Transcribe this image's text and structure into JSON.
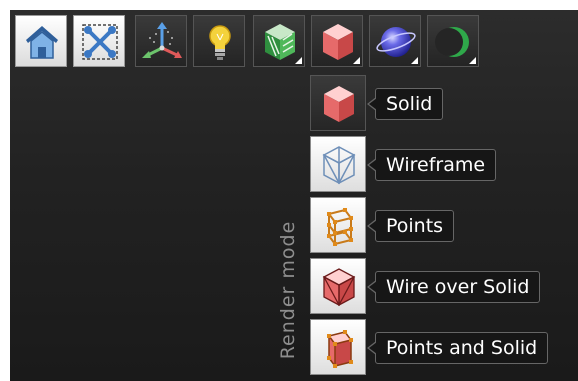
{
  "toolbar": {
    "buttons": [
      {
        "name": "home",
        "icon": "home-icon"
      },
      {
        "name": "fit-view",
        "icon": "fit-view-icon"
      },
      {
        "name": "axes",
        "icon": "axes-icon"
      },
      {
        "name": "light",
        "icon": "lightbulb-icon"
      },
      {
        "name": "shading",
        "icon": "striped-cube-icon"
      },
      {
        "name": "render-mode",
        "icon": "solid-cube-icon"
      },
      {
        "name": "sphere",
        "icon": "sphere-icon"
      },
      {
        "name": "crescent",
        "icon": "crescent-icon"
      }
    ]
  },
  "render_mode_menu": {
    "label": "Render mode",
    "selected": "Solid",
    "items": [
      {
        "label": "Solid",
        "icon": "solid-cube-icon"
      },
      {
        "label": "Wireframe",
        "icon": "wireframe-cube-icon"
      },
      {
        "label": "Points",
        "icon": "points-cube-icon"
      },
      {
        "label": "Wire over Solid",
        "icon": "wire-over-solid-icon"
      },
      {
        "label": "Points and Solid",
        "icon": "points-and-solid-icon"
      }
    ]
  },
  "colors": {
    "background": "#1f1f1f",
    "tooltip_bg": "#161616",
    "tooltip_border": "#666666",
    "cube_red": "#e66a6a",
    "label_grey": "#8e8e8e"
  }
}
